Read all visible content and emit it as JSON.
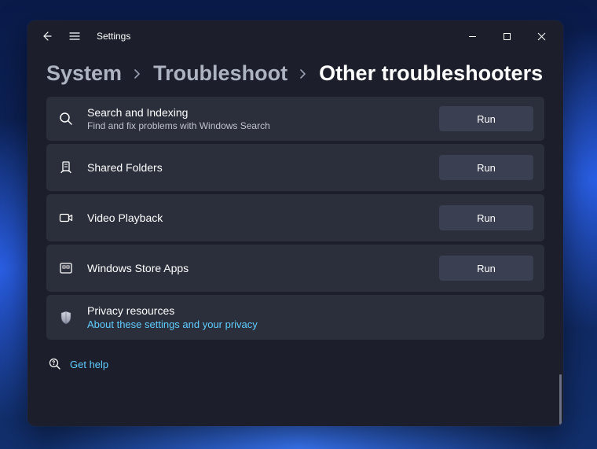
{
  "titlebar": {
    "app_name": "Settings"
  },
  "breadcrumbs": {
    "items": [
      "System",
      "Troubleshoot",
      "Other troubleshooters"
    ],
    "active_index": 2
  },
  "troubleshooters": [
    {
      "icon": "search-icon",
      "title": "Search and Indexing",
      "subtitle": "Find and fix problems with Windows Search",
      "action_label": "Run"
    },
    {
      "icon": "shared-folders-icon",
      "title": "Shared Folders",
      "subtitle": "",
      "action_label": "Run"
    },
    {
      "icon": "video-icon",
      "title": "Video Playback",
      "subtitle": "",
      "action_label": "Run"
    },
    {
      "icon": "store-apps-icon",
      "title": "Windows Store Apps",
      "subtitle": "",
      "action_label": "Run"
    }
  ],
  "privacy": {
    "title": "Privacy resources",
    "link_label": "About these settings and your privacy"
  },
  "footer": {
    "help_label": "Get help"
  }
}
